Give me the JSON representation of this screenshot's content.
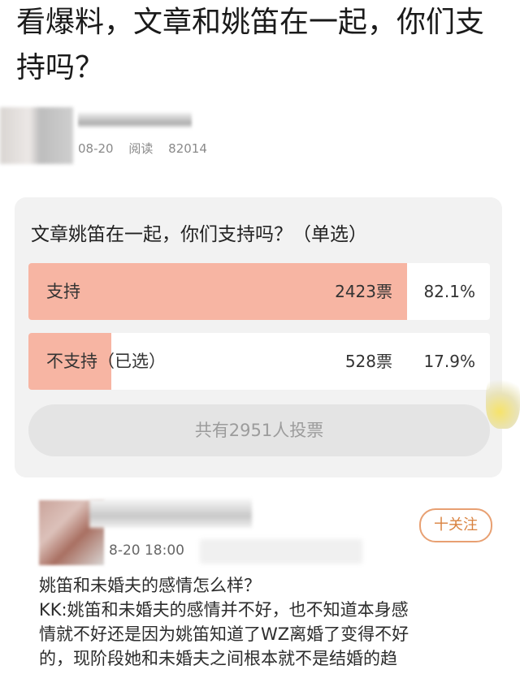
{
  "headline": "看爆料，文章和姚笛在一起，你们支持吗？",
  "author": {
    "date": "08-20",
    "read_label": "阅读",
    "read_count": "82014"
  },
  "poll": {
    "question": "文章姚笛在一起，你们支持吗？（单选）",
    "options": [
      {
        "label": "支持",
        "votes": "2423票",
        "percent": "82.1%",
        "fill_fraction": 0.82
      },
      {
        "label": "不支持（已选）",
        "votes": "528票",
        "percent": "17.9%",
        "fill_fraction": 0.179
      }
    ],
    "total": "共有2951人投票"
  },
  "comment": {
    "time": "8-20 18:00",
    "follow_label": "十关注",
    "lines": [
      "姚笛和未婚夫的感情怎么样？",
      "KK:姚笛和未婚夫的感情并不好，也不知道本身感",
      "情就不好还是因为姚笛知道了WZ离婚了变得不好",
      "的，现阶段她和未婚夫之间根本就不是结婚的趋"
    ]
  },
  "colors": {
    "poll_fill": "#f7b5a3",
    "follow_accent": "#d9823f"
  }
}
